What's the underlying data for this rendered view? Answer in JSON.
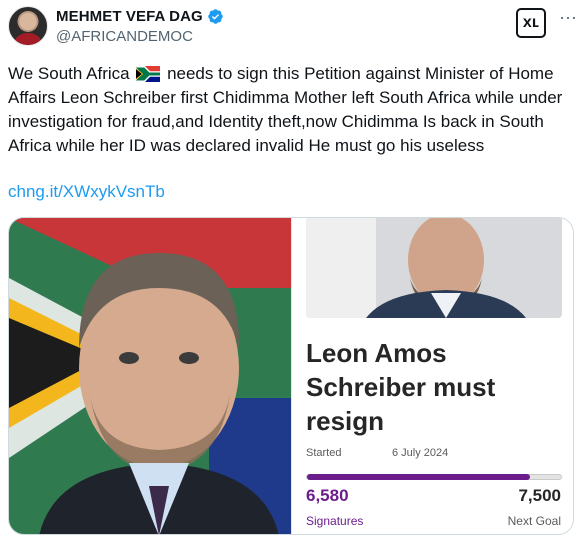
{
  "author": {
    "name": "MEHMET VEFA DAG",
    "handle": "@AFRICANDEMOC",
    "verified": true
  },
  "header_actions": {
    "grok_icon": "xai-logo-icon",
    "grok_label": "xʟ",
    "more_icon": "more-icon",
    "more_label": "···"
  },
  "tweet": {
    "text_part1": "We South Africa",
    "text_part2": "needs to sign this Petition against Minister of Home Affairs Leon Schreiber first Chidimma Mother left South Africa while under investigation for fraud,and Identity theft,now Chidimma Is back in South Africa while her ID was declared invalid He must go his useless",
    "flag_icon": "south-africa-flag-icon",
    "link": "chng.it/XWxykVsnTb"
  },
  "card": {
    "title": "Leon Amos Schreiber must resign",
    "started_label": "Started",
    "started_date": "6 July 2024",
    "signatures": "6,580",
    "signatures_label": "Signatures",
    "goal": "7,500",
    "goal_label": "Next Goal",
    "progress_fraction": 0.877,
    "accent_color": "#6b1d8b"
  },
  "colors": {
    "link": "#1d9bf0",
    "verified": "#1d9bf0",
    "text": "#0f1419",
    "muted": "#536471"
  }
}
